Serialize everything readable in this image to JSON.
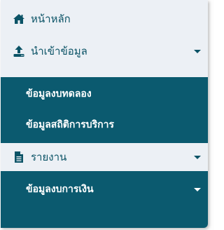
{
  "colors": {
    "panel_bg": "#ecf0f5",
    "accent": "#0b5366",
    "submenu_bg": "#0b5a6f",
    "submenu_text": "#ffffff"
  },
  "menu": {
    "home": {
      "label": "หน้าหลัก",
      "icon": "home-icon"
    },
    "import": {
      "label": "นำเข้าข้อมูล",
      "icon": "upload-icon",
      "children": [
        {
          "label": "ข้อมูลงบทดลอง"
        },
        {
          "label": "ข้อมูลสถิติการบริการ"
        }
      ]
    },
    "report": {
      "label": "รายงาน",
      "icon": "file-icon",
      "children": [
        {
          "label": "ข้อมูลงบการเงิน"
        }
      ]
    }
  }
}
